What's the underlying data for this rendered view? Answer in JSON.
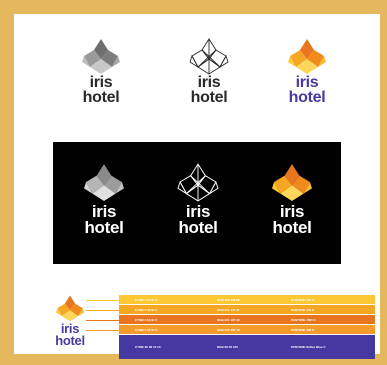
{
  "brand": {
    "line1": "iris",
    "line2": "hotel"
  },
  "colors": {
    "frame": "#e6b85e",
    "dark_text": "#2a2a2a",
    "purple_text": "#4a3aa0",
    "panel": "#000000",
    "orange": "#f5a623",
    "yellow": "#fcc934"
  },
  "palette_rows": [
    {
      "color": "#fcc934",
      "c1": "CYMK 0 60 91 0",
      "c2": "RGB 240 176 88",
      "c3": "PANTONE 130 C"
    },
    {
      "color": "#f5a623",
      "c1": "CYMK 0 60 91 0",
      "c2": "RGB 241 147 31",
      "c3": "PANTONE 144 C"
    },
    {
      "color": "#e8751f",
      "c1": "CYMK 0 60 91 0",
      "c2": "RGB 231 107 33",
      "c3": "PANTONE 1505 C"
    },
    {
      "color": "#f39c2c",
      "c1": "CYMK 0 60 91 0",
      "c2": "RGB 242 156 46",
      "c3": "PANTONE 138 C"
    },
    {
      "color": "#4538a0",
      "c1": "CYMK 90 90 10 10",
      "c2": "RGB 69 56 160",
      "c3": "PANTONE Reflex Blue C"
    }
  ],
  "icons": [
    "iris-flower-icon"
  ]
}
